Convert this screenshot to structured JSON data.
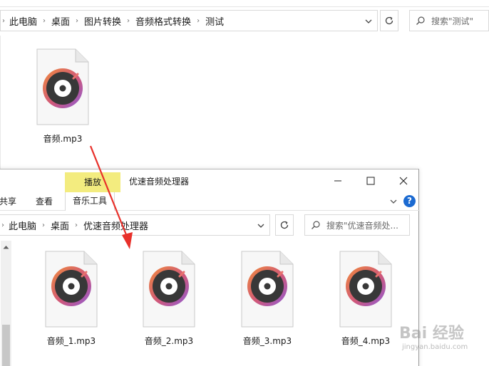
{
  "back_window": {
    "breadcrumbs": [
      "此电脑",
      "桌面",
      "图片转换",
      "音频格式转换",
      "测试"
    ],
    "search_placeholder": "搜索\"测试\"",
    "files": [
      {
        "name": "音频.mp3",
        "icon": "music-disc-icon"
      }
    ]
  },
  "front_window": {
    "title": "优速音频处理器",
    "contextual_tab": "播放",
    "ribbon_tabs": [
      "共享",
      "查看",
      "音乐工具"
    ],
    "breadcrumbs": [
      "此电脑",
      "桌面",
      "优速音频处理器"
    ],
    "search_placeholder": "搜索\"优速音频处...",
    "help_label": "?",
    "files": [
      {
        "name": "音频_1.mp3",
        "icon": "music-disc-icon"
      },
      {
        "name": "音频_2.mp3",
        "icon": "music-disc-icon"
      },
      {
        "name": "音频_3.mp3",
        "icon": "music-disc-icon"
      },
      {
        "name": "音频_4.mp3",
        "icon": "music-disc-icon"
      }
    ]
  },
  "watermark": {
    "main": "Bai 经验",
    "sub": "jingyan.baidu.com"
  },
  "colors": {
    "contextual_tab": "#f3ec7f",
    "annotation_arrow": "#e8302a",
    "help": "#1b6ad1"
  }
}
